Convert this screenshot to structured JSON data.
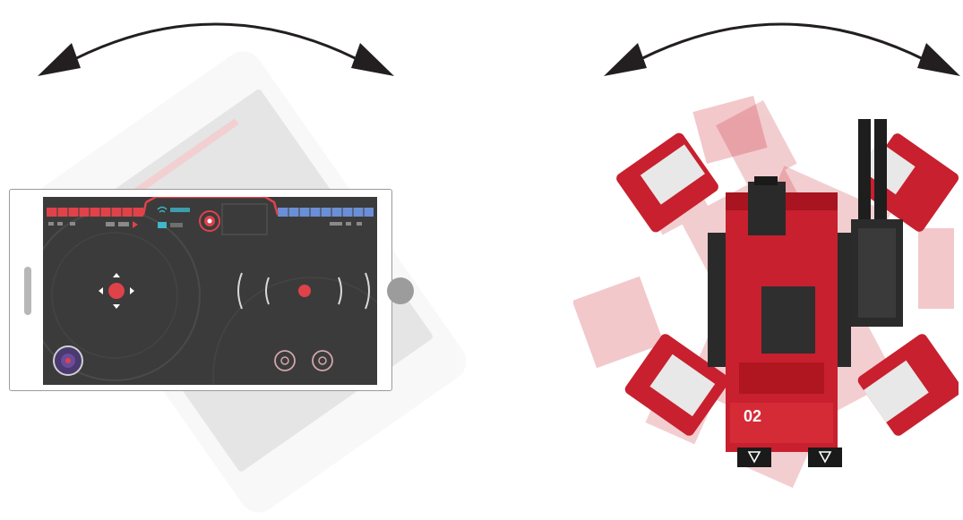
{
  "scene": {
    "left_panel": "phone-tilt-control",
    "right_panel": "robot-rotation"
  },
  "robot": {
    "chassis_marking": "02"
  },
  "colors": {
    "arrow": "#231f20",
    "robot_red": "#c8202e",
    "robot_dark": "#2a2a2a",
    "hud_bg": "#3b3b3b",
    "hud_red": "#e0424a",
    "hud_blue": "#6b8fd6",
    "hud_teal": "#3fb6c9"
  }
}
